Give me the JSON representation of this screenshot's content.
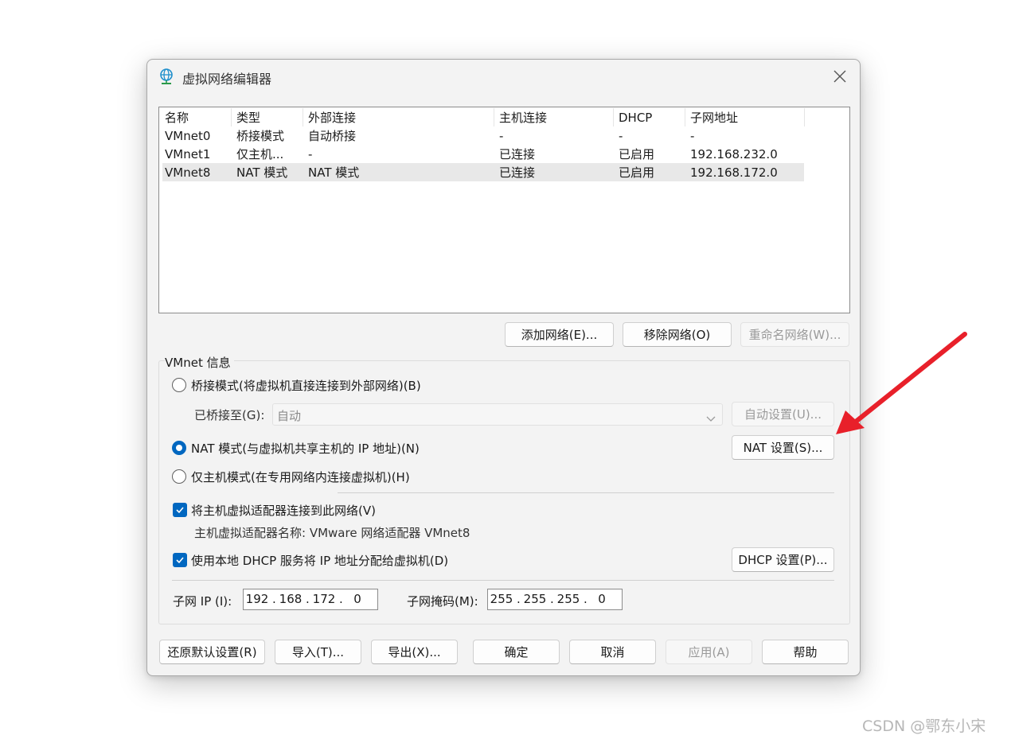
{
  "window": {
    "title": "虚拟网络编辑器"
  },
  "table": {
    "headers": [
      "名称",
      "类型",
      "外部连接",
      "主机连接",
      "DHCP",
      "子网地址"
    ],
    "rows": [
      [
        "VMnet0",
        "桥接模式",
        "自动桥接",
        "-",
        "-",
        "-"
      ],
      [
        "VMnet1",
        "仅主机...",
        "-",
        "已连接",
        "已启用",
        "192.168.232.0"
      ],
      [
        "VMnet8",
        "NAT 模式",
        "NAT 模式",
        "已连接",
        "已启用",
        "192.168.172.0"
      ]
    ],
    "selected_row": 2
  },
  "list_buttons": {
    "add": "添加网络(E)...",
    "remove": "移除网络(O)",
    "rename": "重命名网络(W)..."
  },
  "vmnet_info": {
    "group_label": "VMnet 信息",
    "bridge_mode": "桥接模式(将虚拟机直接连接到外部网络)(B)",
    "bridged_to_label": "已桥接至(G):",
    "bridged_to_value": "自动",
    "auto_settings": "自动设置(U)...",
    "nat_mode": "NAT 模式(与虚拟机共享主机的 IP 地址)(N)",
    "nat_settings": "NAT 设置(S)...",
    "host_only": "仅主机模式(在专用网络内连接虚拟机)(H)",
    "connect_adapter": "将主机虚拟适配器连接到此网络(V)",
    "adapter_name": "主机虚拟适配器名称: VMware 网络适配器 VMnet8",
    "use_dhcp": "使用本地 DHCP 服务将 IP 地址分配给虚拟机(D)",
    "dhcp_settings": "DHCP 设置(P)...",
    "subnet_ip_label": "子网 IP (I):",
    "subnet_ip": [
      "192",
      "168",
      "172",
      "0"
    ],
    "subnet_mask_label": "子网掩码(M):",
    "subnet_mask": [
      "255",
      "255",
      "255",
      "0"
    ],
    "selected_mode": "nat",
    "connect_adapter_checked": true,
    "use_dhcp_checked": true
  },
  "footer_buttons": {
    "restore": "还原默认设置(R)",
    "import": "导入(T)...",
    "export": "导出(X)...",
    "ok": "确定",
    "cancel": "取消",
    "apply": "应用(A)",
    "help": "帮助"
  },
  "watermark": "CSDN @鄂东小宋",
  "colors": {
    "accent": "#0067c0",
    "arrow": "#e8202a",
    "selected_row": "#e8e8e8"
  },
  "icons": {
    "title": "globe-network-icon",
    "close": "close-icon"
  }
}
